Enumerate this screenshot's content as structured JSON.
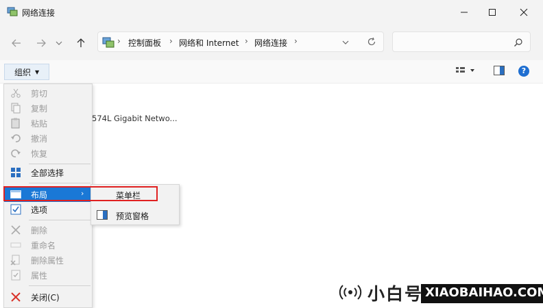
{
  "window": {
    "title": "网络连接",
    "minimize_icon": "minimize-icon",
    "maximize_icon": "maximize-icon",
    "close_icon": "close-icon"
  },
  "nav": {
    "back_icon": "arrow-left-icon",
    "forward_icon": "arrow-right-icon",
    "history_icon": "chevron-down-icon",
    "up_icon": "arrow-up-icon",
    "breadcrumbs": [
      "控制面板",
      "网络和 Internet",
      "网络连接"
    ],
    "refresh_icon": "refresh-icon",
    "search_icon": "search-icon",
    "search_placeholder": ""
  },
  "toolbar": {
    "organize_label": "组织",
    "view_icon": "view-options-icon",
    "preview_icon": "preview-pane-icon",
    "help_icon": "help-icon",
    "help_text": "?"
  },
  "content": {
    "adapter_label": "574L Gigabit Netwo..."
  },
  "menu": {
    "items": [
      {
        "label": "剪切",
        "icon": "scissors-icon",
        "enabled": false
      },
      {
        "label": "复制",
        "icon": "copy-icon",
        "enabled": false
      },
      {
        "label": "粘贴",
        "icon": "paste-icon",
        "enabled": false
      },
      {
        "label": "撤消",
        "icon": "undo-icon",
        "enabled": false
      },
      {
        "label": "恢复",
        "icon": "redo-icon",
        "enabled": false
      },
      {
        "label": "全部选择",
        "icon": "select-all-icon",
        "enabled": true
      },
      {
        "label": "布局",
        "icon": "layout-icon",
        "enabled": true,
        "highlighted": true
      },
      {
        "label": "选项",
        "icon": "options-icon",
        "enabled": true
      },
      {
        "label": "删除",
        "icon": "delete-icon",
        "enabled": false
      },
      {
        "label": "重命名",
        "icon": "rename-icon",
        "enabled": false
      },
      {
        "label": "删除属性",
        "icon": "remove-properties-icon",
        "enabled": false
      },
      {
        "label": "属性",
        "icon": "properties-icon",
        "enabled": false
      },
      {
        "label": "关闭(C)",
        "icon": "close-x-icon",
        "enabled": true
      }
    ]
  },
  "submenu": {
    "items": [
      {
        "label": "菜单栏"
      },
      {
        "label": "预览窗格",
        "icon": "preview-pane-icon"
      }
    ]
  },
  "watermark": {
    "cn": "小白号",
    "en": "XIAOBAIHAO.COM"
  },
  "colors": {
    "highlight": "#1a78d6",
    "annotation_red": "#e02020",
    "help_blue": "#1f6fd1"
  }
}
